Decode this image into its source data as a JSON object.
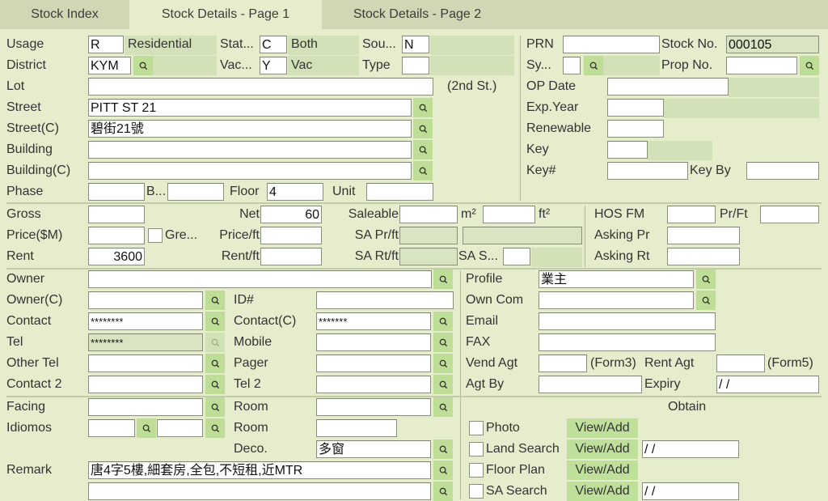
{
  "tabs": [
    {
      "label": "Stock Index",
      "active": false
    },
    {
      "label": "Stock Details - Page 1",
      "active": true
    },
    {
      "label": "Stock Details - Page 2",
      "active": false
    }
  ],
  "colors": {
    "background": "#e6edcd",
    "tabbar": "#cfd7b4",
    "search_button": "#bedd96",
    "readonly_field": "#d9e4c2",
    "view_add_button": "#bfe09a"
  },
  "property": {
    "usage": {
      "label": "Usage",
      "code": "R",
      "desc": "Residential"
    },
    "status": {
      "label": "Stat...",
      "code": "C",
      "desc": "Both"
    },
    "source": {
      "label": "Sou...",
      "code": "N"
    },
    "district": {
      "label": "District",
      "code": "KYM"
    },
    "vacancy": {
      "label": "Vac...",
      "code": "Y",
      "desc": "Vac"
    },
    "type": {
      "label": "Type",
      "code": ""
    },
    "lot": {
      "label": "Lot",
      "value": "",
      "note": "(2nd St.)"
    },
    "street": {
      "label": "Street",
      "value": "PITT ST 21"
    },
    "street_c": {
      "label": "Street(C)",
      "value": "碧街21號"
    },
    "building": {
      "label": "Building",
      "value": ""
    },
    "building_c": {
      "label": "Building(C)",
      "value": ""
    },
    "phase": {
      "label": "Phase",
      "value": ""
    },
    "block": {
      "label": "B...",
      "value": ""
    },
    "floor": {
      "label": "Floor",
      "value": "4"
    },
    "unit": {
      "label": "Unit",
      "value": ""
    }
  },
  "right_top": {
    "prn": {
      "label": "PRN",
      "value": ""
    },
    "stock_no": {
      "label": "Stock No.",
      "value": "000105"
    },
    "sy": {
      "label": "Sy...",
      "value": ""
    },
    "prop_no": {
      "label": "Prop No.",
      "value": ""
    },
    "op_date": {
      "label": "OP Date",
      "value": ""
    },
    "exp_year": {
      "label": "Exp.Year",
      "value": ""
    },
    "renewable": {
      "label": "Renewable",
      "value": ""
    },
    "key": {
      "label": "Key",
      "value": ""
    },
    "key_no": {
      "label": "Key#",
      "value": ""
    },
    "key_by": {
      "label": "Key By",
      "value": ""
    }
  },
  "area": {
    "gross": {
      "label": "Gross",
      "value": ""
    },
    "net": {
      "label": "Net",
      "value": "60"
    },
    "saleable": {
      "label": "Saleable",
      "value_m2": "",
      "unit_m2": "m²",
      "value_ft2": "",
      "unit_ft2": "ft²"
    },
    "price": {
      "label": "Price($M)",
      "value": ""
    },
    "gre": {
      "label": "Gre...",
      "checked": false
    },
    "price_ft": {
      "label": "Price/ft",
      "value": ""
    },
    "sa_pr_ft": {
      "label": "SA Pr/ft",
      "value": ""
    },
    "rent": {
      "label": "Rent",
      "value": "3600"
    },
    "rent_ft": {
      "label": "Rent/ft",
      "value": ""
    },
    "sa_rt_ft": {
      "label": "SA Rt/ft",
      "value": ""
    },
    "sa_s": {
      "label": "SA S...",
      "value": ""
    },
    "hos_fm": {
      "label": "HOS FM",
      "value": ""
    },
    "pr_ft": {
      "label": "Pr/Ft",
      "value": ""
    },
    "asking_pr": {
      "label": "Asking Pr",
      "value": ""
    },
    "asking_rt": {
      "label": "Asking Rt",
      "value": ""
    }
  },
  "owner": {
    "owner": {
      "label": "Owner",
      "value": ""
    },
    "owner_c": {
      "label": "Owner(C)",
      "value": ""
    },
    "id_no": {
      "label": "ID#",
      "value": ""
    },
    "contact": {
      "label": "Contact",
      "value": "********"
    },
    "contact_c": {
      "label": "Contact(C)",
      "value": "*******"
    },
    "tel": {
      "label": "Tel",
      "value": "********"
    },
    "mobile": {
      "label": "Mobile",
      "value": ""
    },
    "other_tel": {
      "label": "Other Tel",
      "value": ""
    },
    "pager": {
      "label": "Pager",
      "value": ""
    },
    "contact2": {
      "label": "Contact 2",
      "value": ""
    },
    "tel2": {
      "label": "Tel 2",
      "value": ""
    },
    "profile": {
      "label": "Profile",
      "value": "業主"
    },
    "own_com": {
      "label": "Own Com",
      "value": ""
    },
    "email": {
      "label": "Email",
      "value": ""
    },
    "fax": {
      "label": "FAX",
      "value": ""
    },
    "vend_agt": {
      "label": "Vend Agt",
      "value": "",
      "note": "(Form3)"
    },
    "rent_agt": {
      "label": "Rent Agt",
      "value": "",
      "note": "(Form5)"
    },
    "agt_by": {
      "label": "Agt By",
      "value": ""
    },
    "expiry": {
      "label": "Expiry",
      "value": " / /"
    }
  },
  "features": {
    "facing": {
      "label": "Facing",
      "value": ""
    },
    "room1": {
      "label": "Room",
      "value": ""
    },
    "idiomos": {
      "label": "Idiomos",
      "value1": "",
      "value2": ""
    },
    "room2": {
      "label": "Room",
      "value": ""
    },
    "deco": {
      "label": "Deco.",
      "value": "多窗"
    },
    "remark": {
      "label": "Remark",
      "line1": "唐4字5樓,細套房,全包,不短租,近MTR",
      "line2": ""
    }
  },
  "obtain": {
    "header": "Obtain",
    "items": [
      {
        "label": "Photo",
        "checked": false,
        "button": "View/Add",
        "date": null
      },
      {
        "label": "Land Search",
        "checked": false,
        "button": "View/Add",
        "date": " / /"
      },
      {
        "label": "Floor Plan",
        "checked": false,
        "button": "View/Add",
        "date": null
      },
      {
        "label": "SA Search",
        "checked": false,
        "button": "View/Add",
        "date": " / /"
      }
    ]
  }
}
